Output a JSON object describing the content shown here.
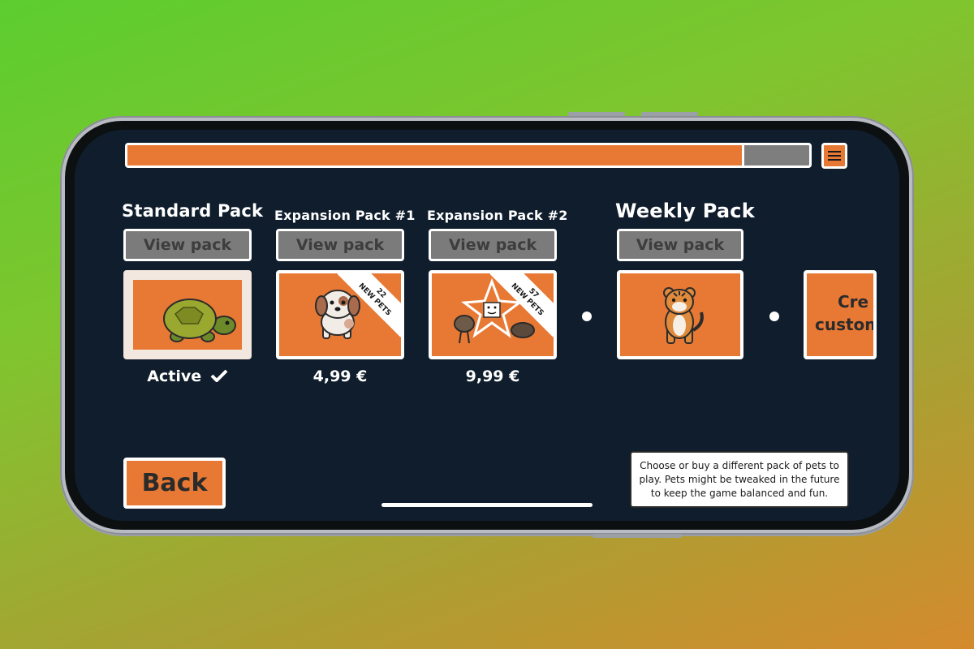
{
  "progress": {
    "value": 0.905
  },
  "menu": {
    "icon": "menu-icon"
  },
  "packs": [
    {
      "title": "Standard Pack",
      "view_label": "View pack",
      "below": "Active",
      "below_icon": "checkmark-icon",
      "pet_icon": "turtle-icon"
    },
    {
      "title": "Expansion Pack #1",
      "view_label": "View pack",
      "below": "4,99 €",
      "pet_icon": "puppy-icon",
      "ribbon_count": "22",
      "ribbon_text": "NEW PETS"
    },
    {
      "title": "Expansion Pack #2",
      "view_label": "View pack",
      "below": "9,99 €",
      "pet_icon": "starfish-icon",
      "ribbon_count": "57",
      "ribbon_text": "NEW PETS"
    },
    {
      "title": "Weekly Pack",
      "view_label": "View pack",
      "pet_icon": "tiger-icon"
    }
  ],
  "custom": {
    "line1": "Cre",
    "line2": "custom"
  },
  "back_label": "Back",
  "info_text": "Choose or buy a different pack of pets to play. Pets might be tweaked in the future to keep the game balanced and fun.",
  "colors": {
    "accent": "#e87934",
    "screen_bg": "#0f1d2c",
    "button_gray": "#7b7b7b"
  }
}
